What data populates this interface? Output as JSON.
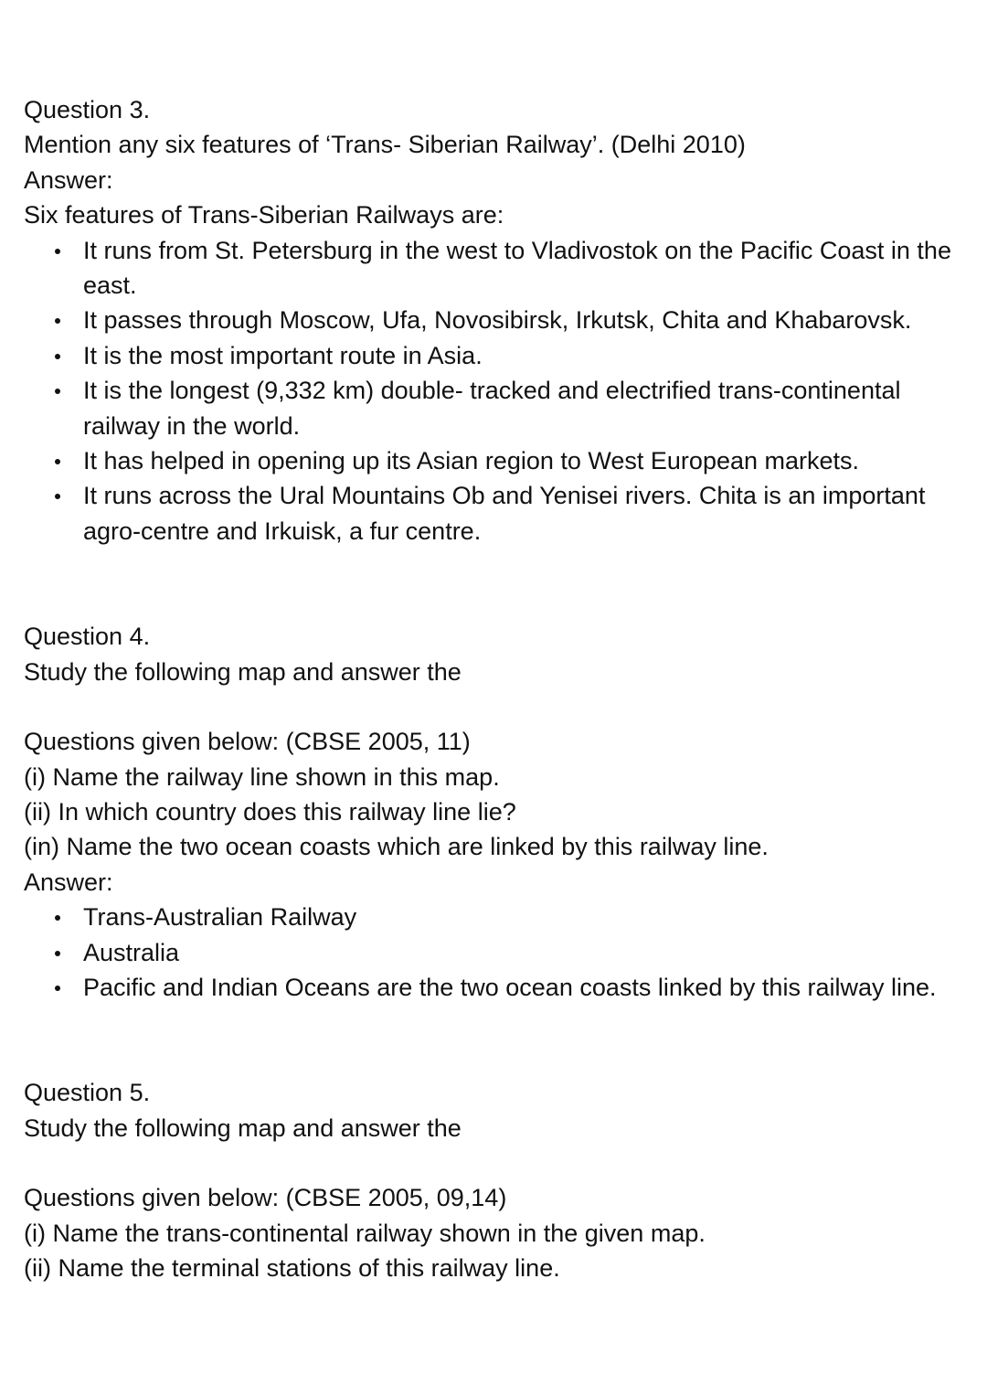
{
  "q3": {
    "heading": "Question 3.",
    "prompt": "Mention any six features of ‘Trans- Siberian Railway’. (Delhi 2010)",
    "answer_label": "Answer:",
    "intro": "Six features of Trans-Siberian Railways are:",
    "bullets": [
      "It runs from St. Petersburg in the west to Vladivostok on the Pacific Coast in the east.",
      "It passes through Moscow, Ufa, Novosibirsk, Irkutsk, Chita and Khabarovsk.",
      "It is the most important route in Asia.",
      "It is the longest (9,332 km) double- tracked and electrified trans-continental railway in the world.",
      "It has helped in opening up its Asian region to West European markets.",
      "It runs across the Ural Mountains Ob and Yenisei rivers. Chita is an important agro-centre and Irkuisk, a fur centre."
    ]
  },
  "q4": {
    "heading": "Question 4.",
    "prompt": "Study the following map and answer the",
    "prompt2": "Questions given below: (CBSE 2005, 11)",
    "sub_questions": [
      "(i) Name the railway line shown in this map.",
      "(ii) In which country does this railway line lie?",
      "(in) Name the two ocean coasts which are linked by this railway line."
    ],
    "answer_label": "Answer:",
    "bullets": [
      "Trans-Australian Railway",
      "Australia",
      "Pacific and Indian Oceans are the two ocean coasts linked by this railway line."
    ]
  },
  "q5": {
    "heading": "Question 5.",
    "prompt": "Study the following map and answer the",
    "prompt2": "Questions given below: (CBSE 2005, 09,14)",
    "sub_questions": [
      "(i) Name the trans-continental railway shown in the given map.",
      "(ii) Name the terminal stations of this railway line."
    ]
  }
}
